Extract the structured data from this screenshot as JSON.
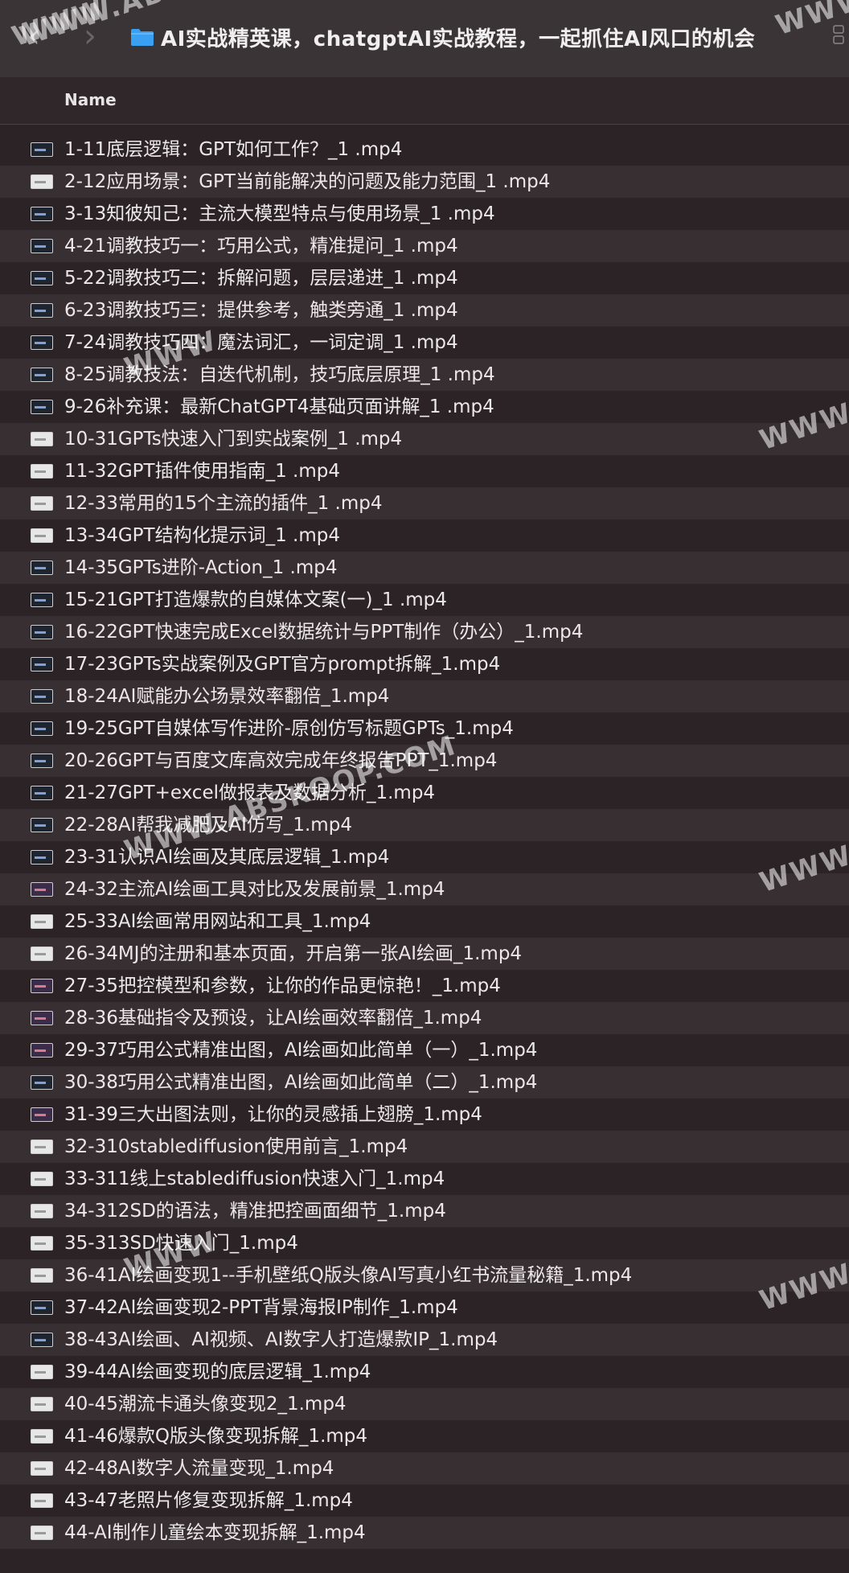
{
  "window": {
    "title": "AI实战精英课，chatgptAI实战教程，一起抓住AI风口的机会",
    "back_icon": "chevron-left-icon",
    "forward_icon": "chevron-right-icon",
    "folder_icon": "folder-icon",
    "folder_color": "#3aa0f2"
  },
  "list_header": {
    "name_label": "Name"
  },
  "files": [
    {
      "name": "1-11底层逻辑：GPT如何工作？_1  .mp4",
      "thumb": "dark"
    },
    {
      "name": "2-12应用场景：GPT当前能解决的问题及能力范围_1  .mp4",
      "thumb": "light"
    },
    {
      "name": "3-13知彼知己：主流大模型特点与使用场景_1  .mp4",
      "thumb": "dark"
    },
    {
      "name": "4-21调教技巧一：巧用公式，精准提问_1  .mp4",
      "thumb": "dark"
    },
    {
      "name": "5-22调教技巧二：拆解问题，层层递进_1  .mp4",
      "thumb": "dark"
    },
    {
      "name": "6-23调教技巧三：提供参考，触类旁通_1  .mp4",
      "thumb": "dark"
    },
    {
      "name": "7-24调教技巧四：魔法词汇，一词定调_1  .mp4",
      "thumb": "dark"
    },
    {
      "name": "8-25调教技法：自迭代机制，技巧底层原理_1  .mp4",
      "thumb": "dark"
    },
    {
      "name": "9-26补充课：最新ChatGPT4基础页面讲解_1  .mp4",
      "thumb": "dark"
    },
    {
      "name": "10-31GPTs快速入门到实战案例_1  .mp4",
      "thumb": "light"
    },
    {
      "name": "11-32GPT插件使用指南_1  .mp4",
      "thumb": "light"
    },
    {
      "name": "12-33常用的15个主流的插件_1  .mp4",
      "thumb": "light"
    },
    {
      "name": "13-34GPT结构化提示词_1  .mp4",
      "thumb": "light"
    },
    {
      "name": "14-35GPTs进阶-Action_1  .mp4",
      "thumb": "dark"
    },
    {
      "name": "15-21GPT打造爆款的自媒体文案(一)_1  .mp4",
      "thumb": "dark"
    },
    {
      "name": "16-22GPT快速完成Excel数据统计与PPT制作（办公）_1.mp4",
      "thumb": "dark"
    },
    {
      "name": "17-23GPTs实战案例及GPT官方prompt拆解_1.mp4",
      "thumb": "dark"
    },
    {
      "name": "18-24AI赋能办公场景效率翻倍_1.mp4",
      "thumb": "dark"
    },
    {
      "name": "19-25GPT自媒体写作进阶-原创仿写标题GPTs_1.mp4",
      "thumb": "dark"
    },
    {
      "name": "20-26GPT与百度文库高效完成年终报告PPT_1.mp4",
      "thumb": "dark"
    },
    {
      "name": "21-27GPT+excel做报表及数据分析_1.mp4",
      "thumb": "dark"
    },
    {
      "name": "22-28AI帮我减肥及AI仿写_1.mp4",
      "thumb": "dark"
    },
    {
      "name": "23-31认识AI绘画及其底层逻辑_1.mp4",
      "thumb": "dark"
    },
    {
      "name": "24-32主流AI绘画工具对比及发展前景_1.mp4",
      "thumb": "mixed"
    },
    {
      "name": "25-33AI绘画常用网站和工具_1.mp4",
      "thumb": "light"
    },
    {
      "name": "26-34MJ的注册和基本页面，开启第一张AI绘画_1.mp4",
      "thumb": "light"
    },
    {
      "name": "27-35把控模型和参数，让你的作品更惊艳！_1.mp4",
      "thumb": "mixed"
    },
    {
      "name": "28-36基础指令及预设，让AI绘画效率翻倍_1.mp4",
      "thumb": "mixed"
    },
    {
      "name": "29-37巧用公式精准出图，AI绘画如此简单（一）_1.mp4",
      "thumb": "mixed"
    },
    {
      "name": "30-38巧用公式精准出图，AI绘画如此简单（二）_1.mp4",
      "thumb": "dark"
    },
    {
      "name": "31-39三大出图法则，让你的灵感插上翅膀_1.mp4",
      "thumb": "mixed"
    },
    {
      "name": "32-310stablediffusion使用前言_1.mp4",
      "thumb": "light"
    },
    {
      "name": "33-311线上stablediffusion快速入门_1.mp4",
      "thumb": "light"
    },
    {
      "name": "34-312SD的语法，精准把控画面细节_1.mp4",
      "thumb": "light"
    },
    {
      "name": "35-313SD快速入门_1.mp4",
      "thumb": "light"
    },
    {
      "name": "36-41AI绘画变现1--手机壁纸Q版头像AI写真小红书流量秘籍_1.mp4",
      "thumb": "light"
    },
    {
      "name": "37-42AI绘画变现2-PPT背景海报IP制作_1.mp4",
      "thumb": "dark"
    },
    {
      "name": "38-43AI绘画、AI视频、AI数字人打造爆款IP_1.mp4",
      "thumb": "dark"
    },
    {
      "name": "39-44AI绘画变现的底层逻辑_1.mp4",
      "thumb": "light"
    },
    {
      "name": "40-45潮流卡通头像变现2_1.mp4",
      "thumb": "light"
    },
    {
      "name": "41-46爆款Q版头像变现拆解_1.mp4",
      "thumb": "light"
    },
    {
      "name": "42-48AI数字人流量变现_1.mp4",
      "thumb": "light"
    },
    {
      "name": "43-47老照片修复变现拆解_1.mp4",
      "thumb": "light"
    },
    {
      "name": "44-AI制作儿童绘本变现拆解_1.mp4",
      "thumb": "light"
    }
  ],
  "watermarks": [
    "WWW.ABSKOOP.COM",
    "WWW",
    "WWW",
    "WWW.ABSKOOP.COM",
    "WWW",
    "WWW.ABSKOOP.COM",
    "WWW",
    "WWW",
    "WWW"
  ]
}
